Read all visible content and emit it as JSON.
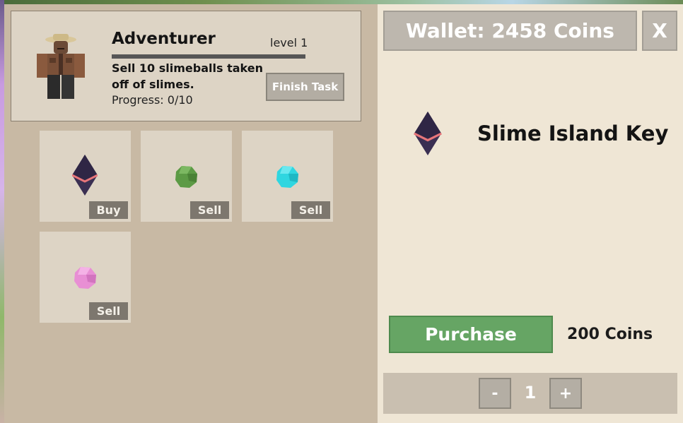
{
  "quest": {
    "npc_name": "Adventurer",
    "level": "level 1",
    "description": "Sell 10 slimeballs taken off of slimes.",
    "progress": "Progress: 0/10",
    "progress_fraction": 0.0,
    "finish_label": "Finish Task"
  },
  "items": [
    {
      "icon": "key-gem-icon",
      "action": "Buy",
      "color": "#3a2f52"
    },
    {
      "icon": "green-slimeball-icon",
      "action": "Sell",
      "color": "#5c9a45"
    },
    {
      "icon": "cyan-slimeball-icon",
      "action": "Sell",
      "color": "#2fd6e0"
    },
    {
      "icon": "pink-slimeball-icon",
      "action": "Sell",
      "color": "#e88fd4"
    }
  ],
  "shop": {
    "wallet": "Wallet: 2458 Coins",
    "close_label": "X",
    "selected_item": "Slime Island Key",
    "purchase_label": "Purchase",
    "price": "200 Coins",
    "quantity": "1",
    "decrement_label": "-",
    "increment_label": "+"
  },
  "colors": {
    "left_panel": "#c8b9a4",
    "right_panel": "#efe6d5",
    "purchase_green": "#66a564",
    "slot_bg": "#ddd4c5"
  }
}
